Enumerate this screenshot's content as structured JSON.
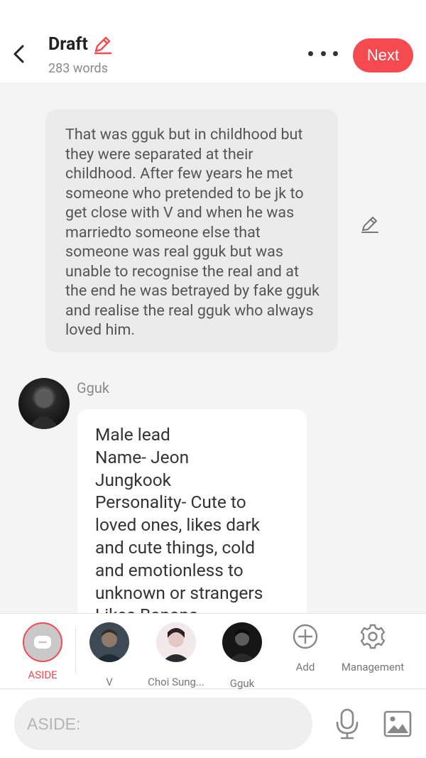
{
  "header": {
    "title": "Draft",
    "word_count": "283 words",
    "next_label": "Next"
  },
  "chat": {
    "aside_text": "That was gguk but in childhood but they were separated at their childhood. After few years he met someone who pretended to be jk to get close with V and when he was marriedto someone else that someone was real gguk but was unable to recognise the real and at the end he was betrayed by fake gguk and realise the real gguk who always loved him.",
    "speaker": "Gguk",
    "message_lines": [
      "Male lead",
      "Name- Jeon",
      "Jungkook",
      "Personality- Cute to",
      "loved ones, likes dark",
      "and cute things, cold",
      "and emotionless to",
      "unknown or strangers",
      "Likes Banana"
    ]
  },
  "cast": [
    {
      "label": "ASIDE",
      "selected": true
    },
    {
      "label": "V"
    },
    {
      "label": "Choi Sung..."
    },
    {
      "label": "Gguk"
    },
    {
      "label": "Add"
    },
    {
      "label": "Management"
    }
  ],
  "input": {
    "placeholder": "ASIDE:"
  },
  "colors": {
    "accent": "#f44a50",
    "header_bg": "#ffffff",
    "chat_bg": "#f4f4f4",
    "aside_bubble": "#ebebeb",
    "message_bubble": "#ffffff"
  },
  "icons": [
    "back-arrow-icon",
    "pencil-icon",
    "more-dots-icon",
    "microphone-icon",
    "image-icon",
    "add-circle-icon",
    "gear-icon"
  ]
}
